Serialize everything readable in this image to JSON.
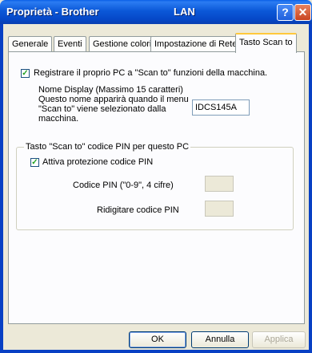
{
  "window": {
    "title_left": "Proprietà - Brother",
    "title_right": "LAN",
    "help_glyph": "?",
    "close_glyph": "✕"
  },
  "tabs": [
    {
      "label": "Generale"
    },
    {
      "label": "Eventi"
    },
    {
      "label": "Gestione colori"
    },
    {
      "label": "Impostazione di Rete"
    },
    {
      "label": "Tasto Scan to",
      "active": true
    }
  ],
  "content": {
    "register_checkbox_label": "Registrare il proprio PC a \"Scan to\" funzioni della macchina.",
    "register_checked": true,
    "display_name_line1": "Nome Display (Massimo 15 caratteri)",
    "display_name_line2": "Questo nome apparirà quando il menu",
    "display_name_line3": "\"Scan to\" viene selezionato dalla",
    "display_name_line4": "macchina.",
    "display_name_value": "IDCS145A",
    "group_title": "Tasto \"Scan to\" codice PIN per questo PC",
    "pin_checkbox_label": "Attiva protezione codice PIN",
    "pin_checked": true,
    "pin_label": "Codice PIN (\"0-9\", 4 cifre)",
    "pin_value": "",
    "repin_label": "Ridigitare codice PIN",
    "repin_value": ""
  },
  "buttons": {
    "ok": "OK",
    "cancel": "Annulla",
    "apply": "Applica"
  },
  "colors": {
    "titlebar": "#0a58d8",
    "face": "#ece9d8",
    "active_tab_accent": "#ffc83c"
  }
}
